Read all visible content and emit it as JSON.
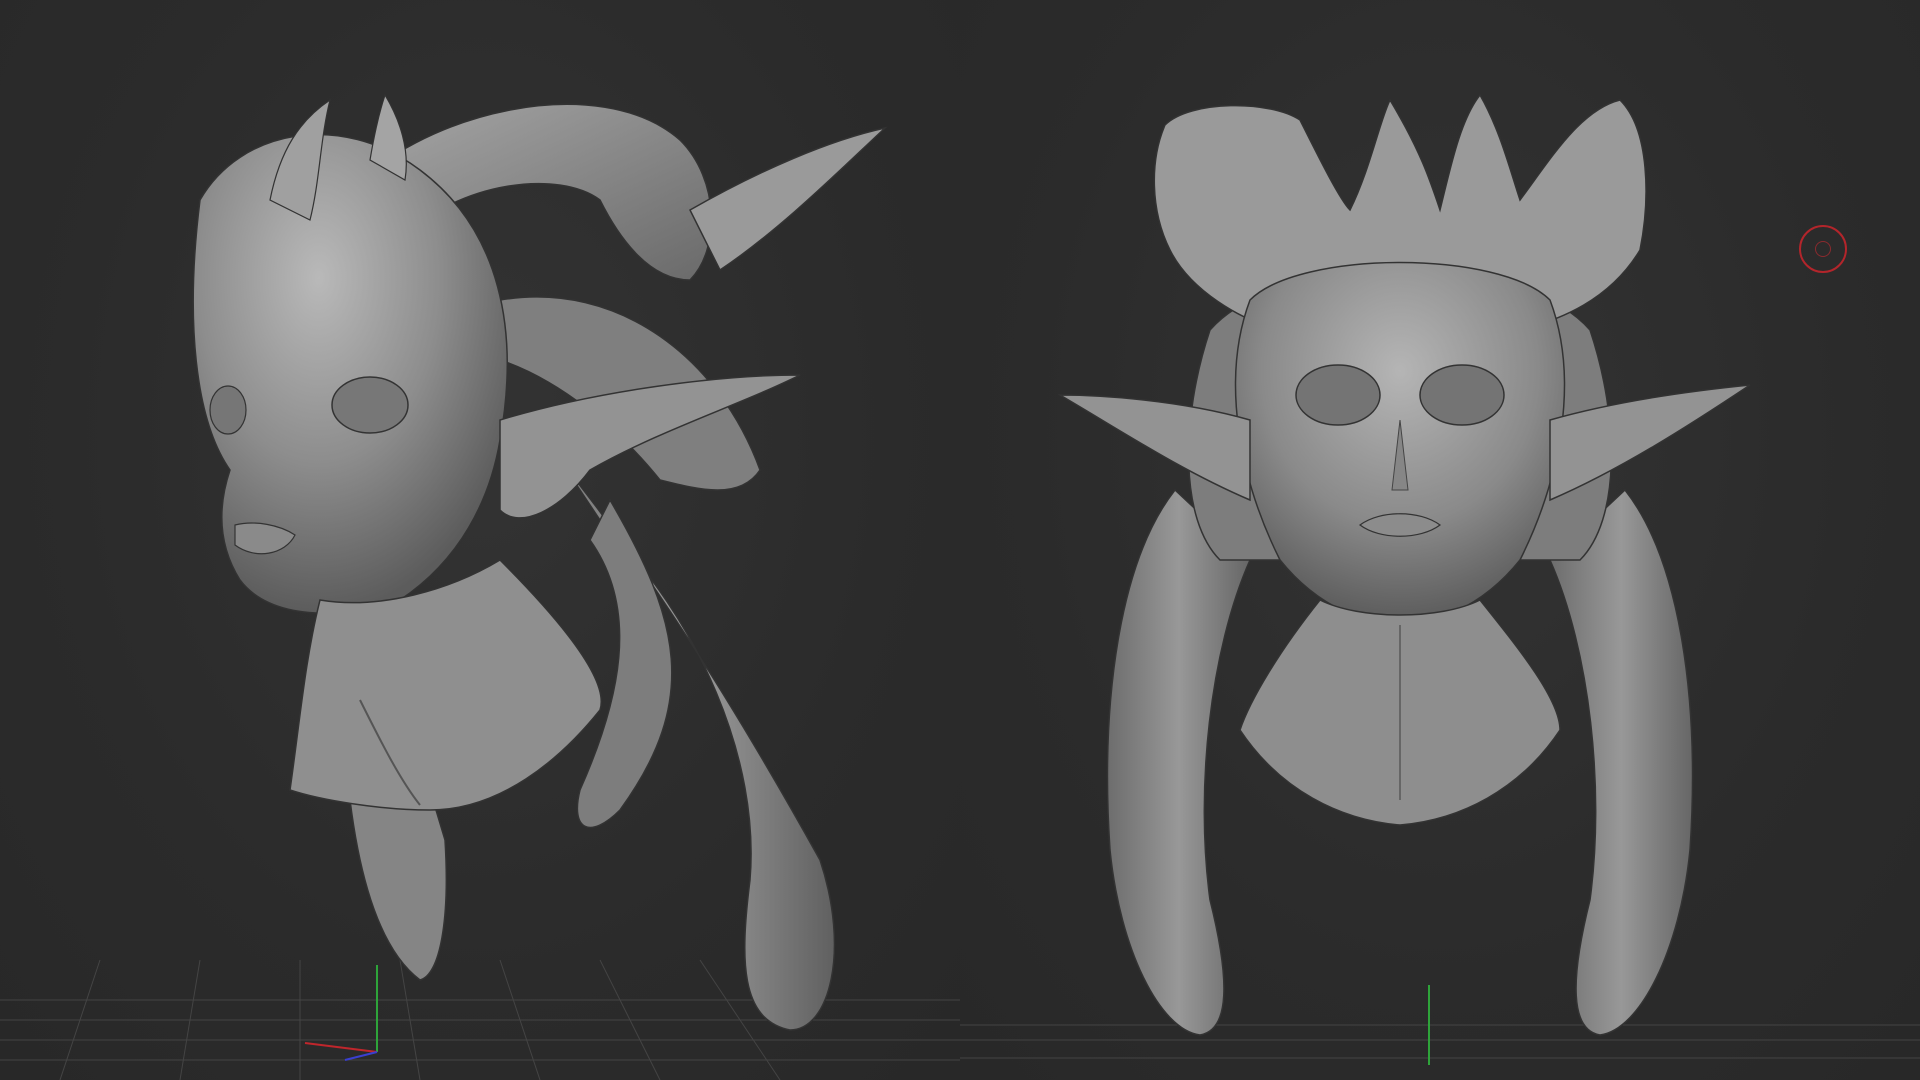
{
  "app": {
    "window_title": ""
  },
  "viewports": [
    {
      "name": "three-quarter-view",
      "view": "perspective"
    },
    {
      "name": "front-view",
      "view": "front"
    }
  ],
  "colors": {
    "background": "#2b2b2b",
    "grid": "#4a4a4a",
    "model": "#8a8a8a",
    "axis_x": "#c0262c",
    "axis_y": "#2ea43a",
    "axis_z": "#3a3fd0",
    "brush_cursor": "#b3252b"
  },
  "icons": {
    "brush_cursor": "circle-brush-icon",
    "axis_gizmo": "xyz-axis-icon"
  }
}
